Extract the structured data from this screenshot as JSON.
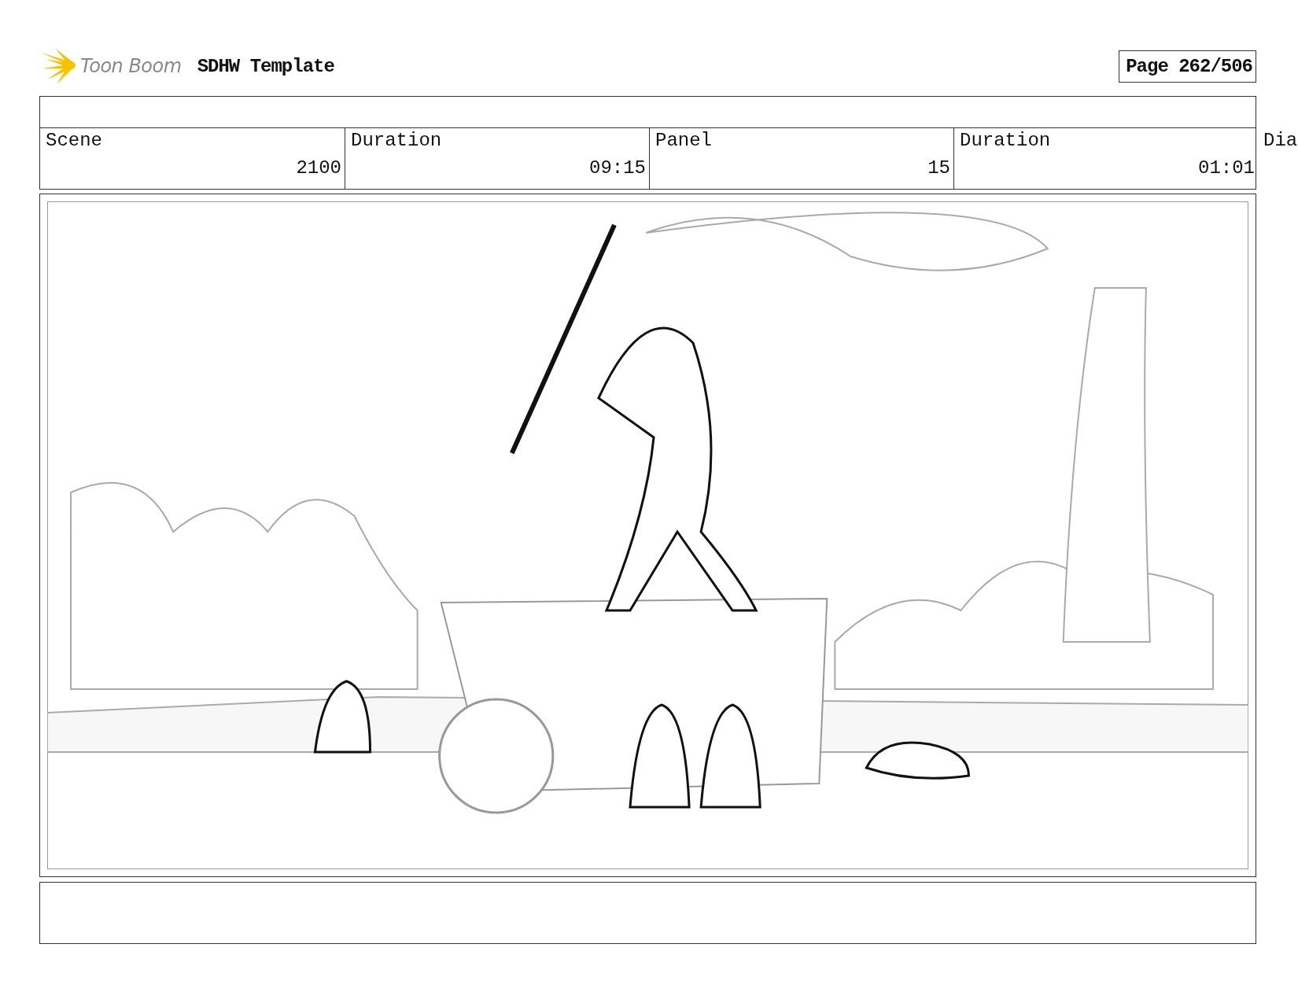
{
  "header": {
    "logo_text": "Toon Boom",
    "title": "SDHW Template",
    "page": "Page 262/506"
  },
  "info_table": {
    "label_row": [
      "Scene",
      "Duration",
      "Panel",
      "Duration",
      "Dia"
    ],
    "value_row": [
      "2100",
      "09:15",
      "15",
      "01:01"
    ]
  }
}
